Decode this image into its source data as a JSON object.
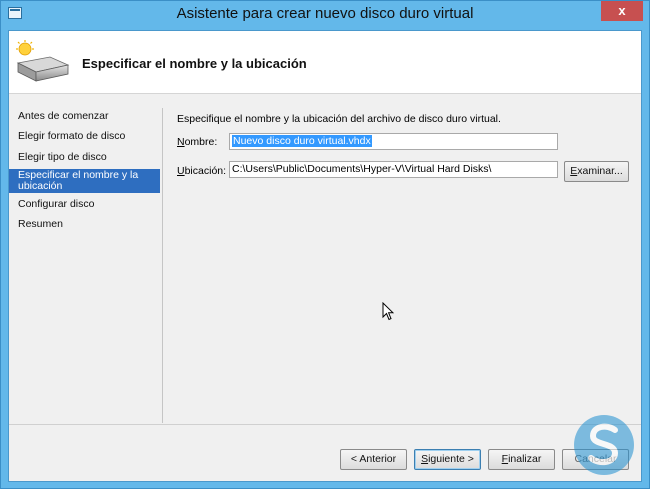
{
  "window": {
    "title": "Asistente para crear nuevo disco duro virtual",
    "close_glyph": "x"
  },
  "header": {
    "title": "Especificar el nombre y la ubicación",
    "icon": "disk-drive-icon"
  },
  "nav": {
    "items": [
      {
        "label": "Antes de comenzar",
        "selected": false
      },
      {
        "label": "Elegir formato de disco",
        "selected": false
      },
      {
        "label": "Elegir tipo de disco",
        "selected": false
      },
      {
        "label": "Especificar el nombre y la ubicación",
        "selected": true
      },
      {
        "label": "Configurar disco",
        "selected": false
      },
      {
        "label": "Resumen",
        "selected": false
      }
    ]
  },
  "main": {
    "description": "Especifique el nombre y la ubicación del archivo de disco duro virtual.",
    "name_label_u": "N",
    "name_label_rest": "ombre:",
    "name_value": "Nuevo disco duro virtual.vhdx",
    "location_label_u": "U",
    "location_label_rest": "bicación:",
    "location_value": "C:\\Users\\Public\\Documents\\Hyper-V\\Virtual Hard Disks\\",
    "browse_u": "E",
    "browse_rest": "xaminar..."
  },
  "footer": {
    "prev": "< Anterior",
    "next_u": "S",
    "next_rest": "iguiente >",
    "finish_u": "F",
    "finish_rest": "inalizar",
    "cancel": "Cancelar"
  },
  "colors": {
    "title_bar": "#63b8ea",
    "selected_nav": "#2e6ec0",
    "close_button": "#c75050"
  }
}
